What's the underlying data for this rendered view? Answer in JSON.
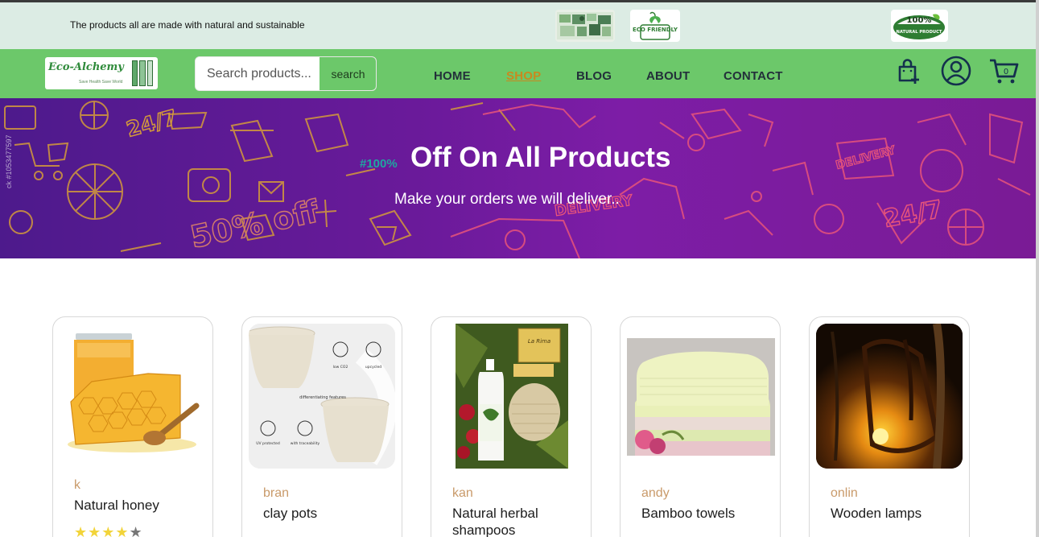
{
  "announcement": {
    "text": "The products all are made with natural and sustainable",
    "badges": [
      {
        "icon": "eco-collage-badge-icon"
      },
      {
        "icon": "eco-friendly-badge-icon",
        "label": "ECO FRIENDLY"
      },
      {
        "icon": "natural-product-badge-icon",
        "label_top": "100%",
        "label_bottom": "NATURAL PRODUCT"
      }
    ]
  },
  "header": {
    "logo": {
      "name": "Eco-Alchemy",
      "tagline": "Save Health Save World"
    },
    "search": {
      "placeholder": "Search products...",
      "button_label": "search"
    },
    "menu": [
      {
        "label": "HOME",
        "active": false
      },
      {
        "label": "SHOP",
        "active": true
      },
      {
        "label": "BLOG",
        "active": false
      },
      {
        "label": "ABOUT",
        "active": false
      },
      {
        "label": "CONTACT",
        "active": false
      }
    ],
    "icons": [
      "shopping-bag-add-icon",
      "user-account-icon",
      "cart-icon"
    ],
    "cart_count": "0"
  },
  "hero": {
    "percent": "#100%",
    "headline": "Off On All Products",
    "subtitle": "Make your orders we will deliver..",
    "side_text": "ck #1053477597",
    "doodle_texts": [
      "24/7",
      "50% off",
      "DELIVERY",
      "DELIVERY",
      "24/7"
    ]
  },
  "products": [
    {
      "vendor": "k",
      "name": "Natural honey",
      "rating": 4,
      "max_rating": 5
    },
    {
      "vendor": "bran",
      "name": "clay pots",
      "image_labels": [
        "low CO2",
        "upcycled",
        "differentiating features",
        "UV protected",
        "with traceability"
      ]
    },
    {
      "vendor": "kan",
      "name": "Natural herbal shampoos",
      "image_labels": [
        "La Rima"
      ]
    },
    {
      "vendor": "andy",
      "name": "Bamboo towels"
    },
    {
      "vendor": "onlin",
      "name": "Wooden lamps"
    }
  ],
  "colors": {
    "nav_green": "#6cc86a",
    "announce_bg": "#dcece4",
    "active_menu": "#c9891f",
    "hero_purple": "#6a1a9a",
    "vendor_text": "#c99a6a",
    "star": "#f2d43a"
  }
}
